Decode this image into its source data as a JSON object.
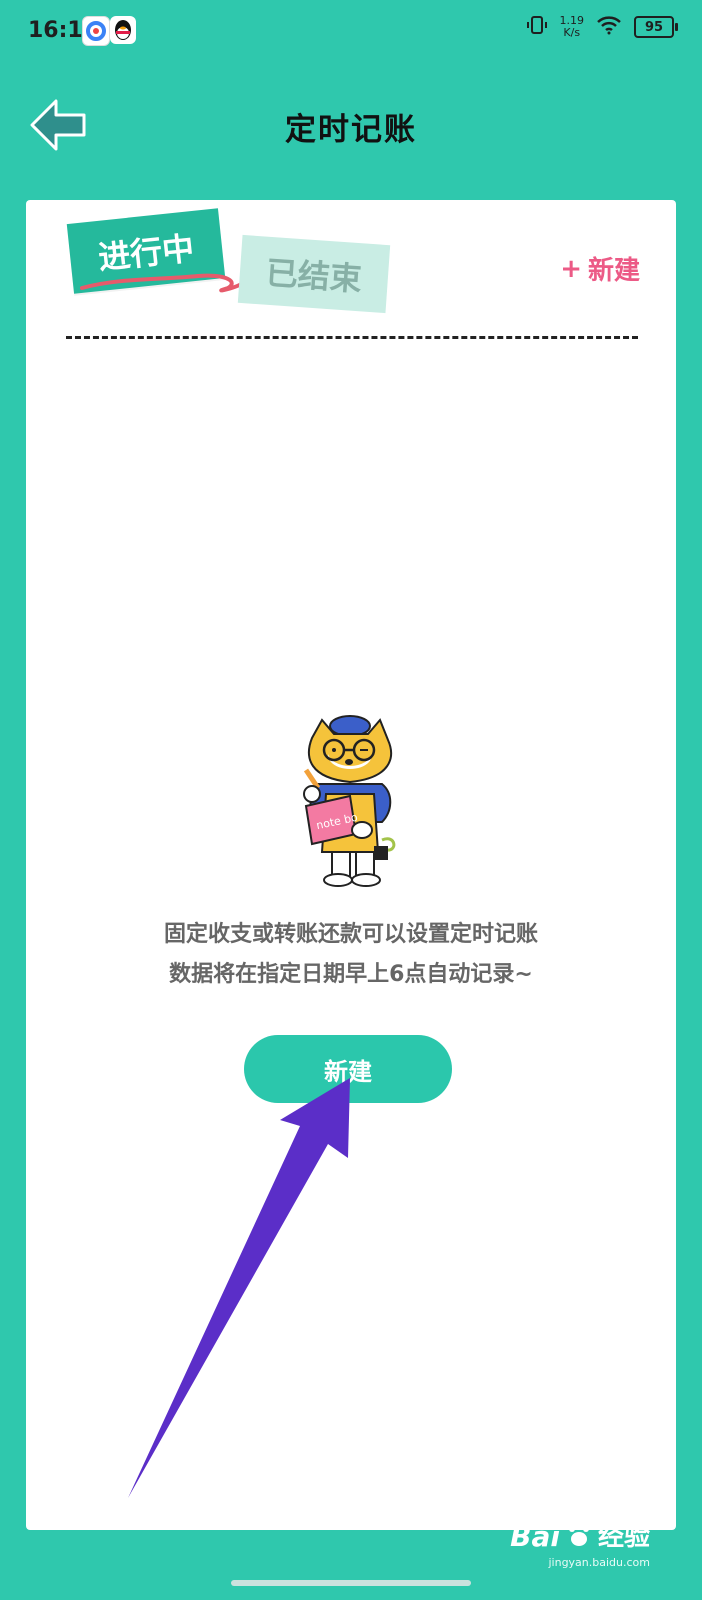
{
  "status_bar": {
    "time": "16:18",
    "net_speed_value": "1.19",
    "net_speed_unit": "K/s",
    "battery": "95"
  },
  "header": {
    "title": "定时记账",
    "back_icon": "arrow-left-icon"
  },
  "tabs": [
    {
      "label": "进行中",
      "active": true
    },
    {
      "label": "已结束",
      "active": false
    }
  ],
  "toolbar": {
    "new_label": "新建"
  },
  "empty_state": {
    "line1": "固定收支或转账还款可以设置定时记账",
    "line2": "数据将在指定日期早上6点自动记录~",
    "book_text": "note bo"
  },
  "primary_button": {
    "label": "新建"
  },
  "watermark": {
    "logo": "Bai",
    "text": "经验",
    "url": "jingyan.baidu.com"
  },
  "colors": {
    "background": "#2fc8ad",
    "accent": "#25b99c",
    "new_link": "#ec5a86",
    "annotation_arrow": "#5b2ec8"
  }
}
